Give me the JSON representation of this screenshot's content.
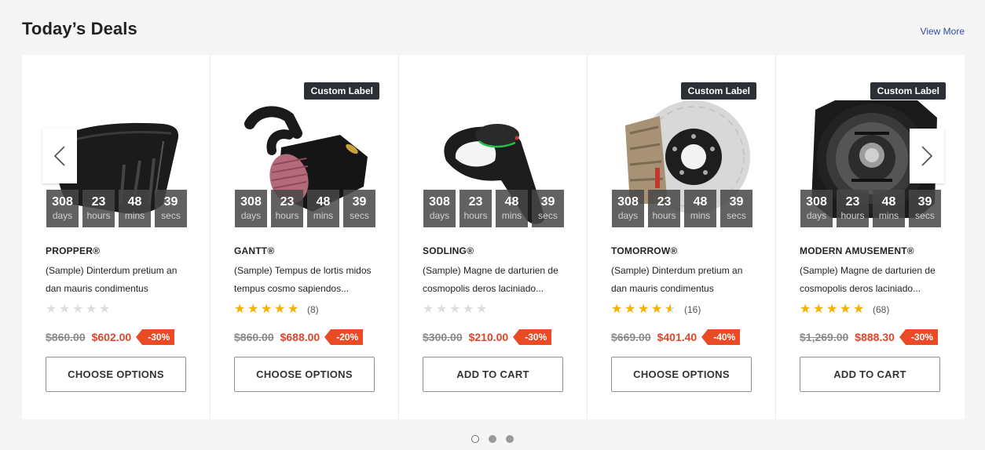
{
  "section": {
    "title": "Today’s Deals",
    "view_more": "View More"
  },
  "products": [
    {
      "brand": "PROPPER®",
      "title": "(Sample) Dinterdum pretium an dan mauris condimentus",
      "label": "",
      "image_icon": "carbon-hood-image",
      "countdown": {
        "days": "308",
        "hours": "23",
        "mins": "48",
        "secs": "39"
      },
      "countdown_units": {
        "days": "days",
        "hours": "hours",
        "mins": "mins",
        "secs": "secs"
      },
      "rating": 0,
      "review_count": "",
      "old_price": "$860.00",
      "new_price": "$602.00",
      "discount": "-30%",
      "button": "CHOOSE OPTIONS"
    },
    {
      "brand": "GANTT®",
      "title": "(Sample) Tempus de lortis midos tempus cosmo sapiendos...",
      "label": "Custom Label",
      "image_icon": "air-intake-filter-image",
      "countdown": {
        "days": "308",
        "hours": "23",
        "mins": "48",
        "secs": "39"
      },
      "countdown_units": {
        "days": "days",
        "hours": "hours",
        "mins": "mins",
        "secs": "secs"
      },
      "rating": 5,
      "review_count": "(8)",
      "old_price": "$860.00",
      "new_price": "$688.00",
      "discount": "-20%",
      "button": "CHOOSE OPTIONS"
    },
    {
      "brand": "SODLING®",
      "title": "(Sample) Magne de darturien de cosmopolis deros laciniado...",
      "label": "",
      "image_icon": "gear-shift-knob-image",
      "countdown": {
        "days": "308",
        "hours": "23",
        "mins": "48",
        "secs": "39"
      },
      "countdown_units": {
        "days": "days",
        "hours": "hours",
        "mins": "mins",
        "secs": "secs"
      },
      "rating": 0,
      "review_count": "",
      "old_price": "$300.00",
      "new_price": "$210.00",
      "discount": "-30%",
      "button": "ADD TO CART"
    },
    {
      "brand": "TOMORROW®",
      "title": "(Sample) Dinterdum pretium an dan mauris condimentus",
      "label": "Custom Label",
      "image_icon": "brake-disc-caliper-image",
      "countdown": {
        "days": "308",
        "hours": "23",
        "mins": "48",
        "secs": "39"
      },
      "countdown_units": {
        "days": "days",
        "hours": "hours",
        "mins": "mins",
        "secs": "secs"
      },
      "rating": 4.5,
      "review_count": "(16)",
      "old_price": "$669.00",
      "new_price": "$401.40",
      "discount": "-40%",
      "button": "CHOOSE OPTIONS"
    },
    {
      "brand": "MODERN AMUSEMENT®",
      "title": "(Sample) Magne de darturien de cosmopolis deros laciniado...",
      "label": "Custom Label",
      "image_icon": "car-speaker-image",
      "countdown": {
        "days": "308",
        "hours": "23",
        "mins": "48",
        "secs": "39"
      },
      "countdown_units": {
        "days": "days",
        "hours": "hours",
        "mins": "mins",
        "secs": "secs"
      },
      "rating": 5,
      "review_count": "(68)",
      "old_price": "$1,269.00",
      "new_price": "$888.30",
      "discount": "-30%",
      "button": "ADD TO CART"
    }
  ],
  "carousel": {
    "prev_icon": "chevron-left-icon",
    "next_icon": "chevron-right-icon",
    "page_count": 3,
    "active_page": 1
  },
  "colors": {
    "sale_red": "#e0452b",
    "badge_red": "#ea4a25",
    "star_gold": "#f5b301",
    "label_dark": "#2b2f36",
    "link_blue": "#2f4fa3"
  }
}
